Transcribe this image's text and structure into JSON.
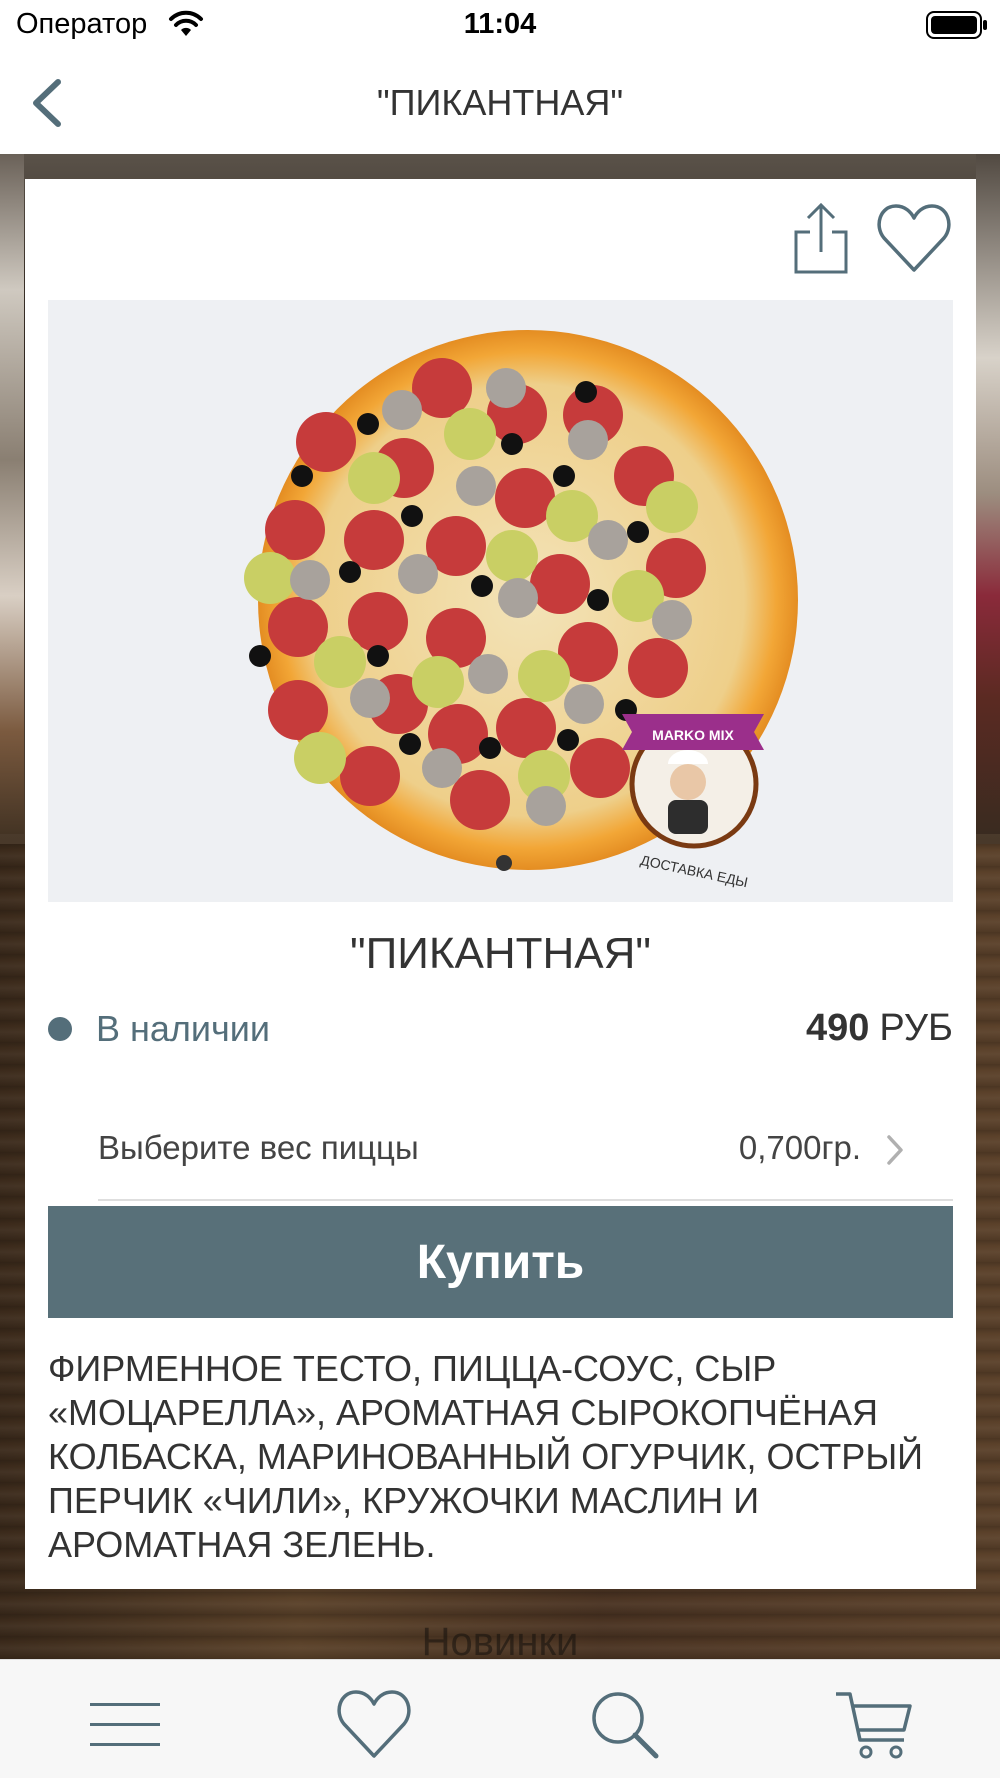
{
  "status_bar": {
    "carrier": "Оператор",
    "time": "11:04"
  },
  "nav": {
    "title": "\"ПИКАНТНАЯ\"",
    "back_icon": "chevron-left-icon"
  },
  "product": {
    "title": "\"ПИКАНТНАЯ\"",
    "availability": "В наличии",
    "price_amount": "490",
    "price_currency": "РУБ",
    "weight_label": "Выберите вес пиццы",
    "weight_value": "0,700гр.",
    "buy_label": "Купить",
    "description": "ФИРМЕННОЕ ТЕСТО, ПИЦЦА-СОУС, СЫР «МОЦАРЕЛЛА», АРОМАТНАЯ СЫРОКОПЧЁНАЯ КОЛБАСКА, МАРИНОВАННЫЙ ОГУРЧИК, ОСТРЫЙ ПЕРЧИК «ЧИЛИ», КРУЖОЧКИ МАСЛИН И АРОМАТНАЯ ЗЕЛЕНЬ.",
    "logo_ribbon_text": "MARKO MIX",
    "logo_caption": "ДОСТАВКА ЕДЫ",
    "image_page_index": 1,
    "image_page_count": 1
  },
  "background": {
    "section_label": "Новинки"
  },
  "tab_bar": {
    "items": [
      "menu-icon",
      "heart-icon",
      "search-icon",
      "cart-icon"
    ]
  },
  "colors": {
    "accent": "#587079",
    "stock_indicator": "#546e7a"
  }
}
